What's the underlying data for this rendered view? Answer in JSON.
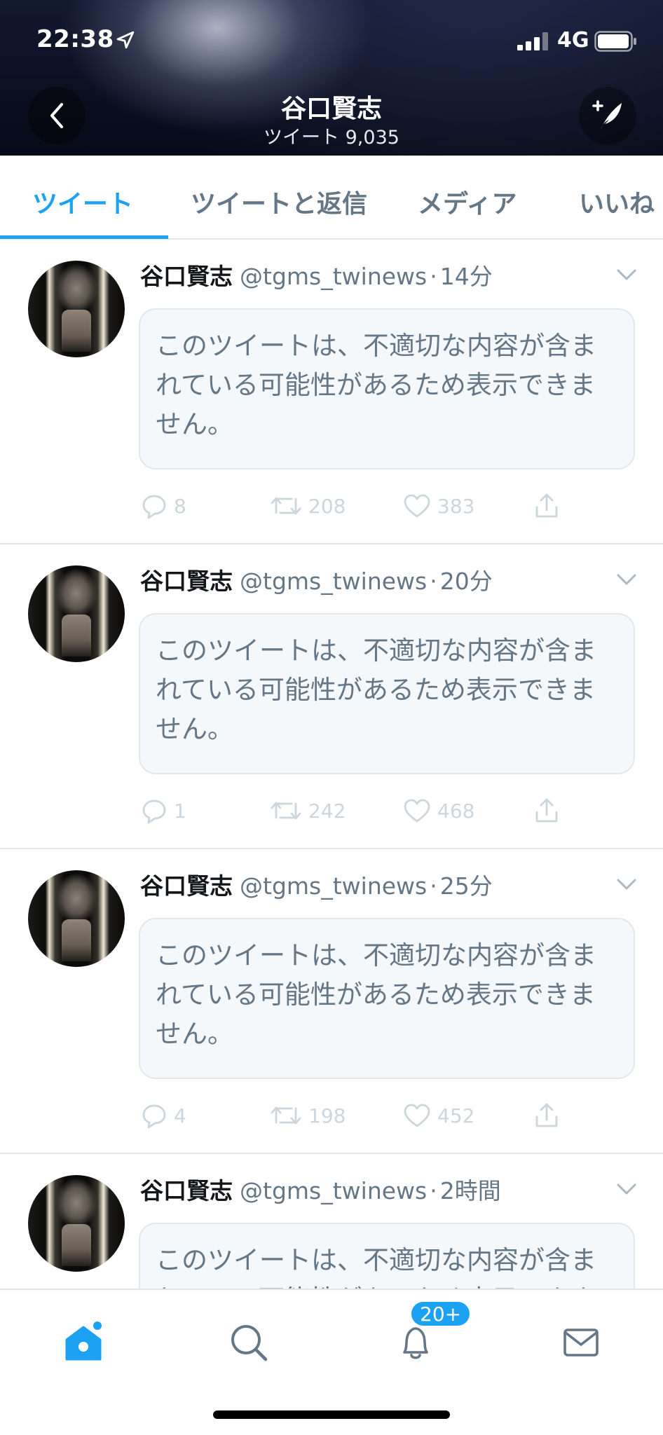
{
  "status_bar": {
    "time": "22:38",
    "network": "4G"
  },
  "header": {
    "title": "谷口賢志",
    "tweet_count": "ツイート 9,035"
  },
  "tabs": [
    {
      "label": "ツイート",
      "active": true
    },
    {
      "label": "ツイートと返信",
      "active": false
    },
    {
      "label": "メディア",
      "active": false
    },
    {
      "label": "いいね",
      "active": false
    }
  ],
  "tweets": [
    {
      "name": "谷口賢志",
      "handle": "@tgms_twinews",
      "sep": "·",
      "time": "14分",
      "notice": "このツイートは、不適切な内容が含まれている可能性があるため表示できません。",
      "replies": "8",
      "retweets": "208",
      "likes": "383"
    },
    {
      "name": "谷口賢志",
      "handle": "@tgms_twinews",
      "sep": "·",
      "time": "20分",
      "notice": "このツイートは、不適切な内容が含まれている可能性があるため表示できません。",
      "replies": "1",
      "retweets": "242",
      "likes": "468"
    },
    {
      "name": "谷口賢志",
      "handle": "@tgms_twinews",
      "sep": "·",
      "time": "25分",
      "notice": "このツイートは、不適切な内容が含まれている可能性があるため表示できません。",
      "replies": "4",
      "retweets": "198",
      "likes": "452"
    },
    {
      "name": "谷口賢志",
      "handle": "@tgms_twinews",
      "sep": "·",
      "time": "2時間",
      "notice": "このツイートは、不適切な内容が含まれている可能性があるため表示できません。",
      "replies": "",
      "retweets": "",
      "likes": ""
    }
  ],
  "tabbar": {
    "notifications_badge": "20+"
  },
  "colors": {
    "accent": "#1da1f2",
    "muted": "#657786",
    "icon_light": "#ccd6dd",
    "border": "#e1e8ed"
  }
}
